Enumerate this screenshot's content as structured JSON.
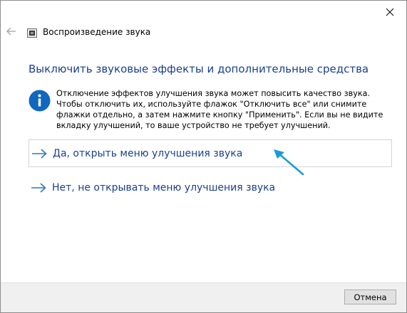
{
  "window": {
    "title": "Воспроизведение звука"
  },
  "heading": "Выключить звуковые эффекты и дополнительные средства",
  "info": {
    "text": "Отключение эффектов улучшения звука может повысить качество звука. Чтобы отключить их, используйте флажок \"Отключить все\" или снимите флажки отдельно, а затем нажмите кнопку \"Применить\". Если вы не видите вкладку улучшений, то ваше устройство не требует улучшений."
  },
  "options": [
    {
      "label": "Да, открыть меню улучшения звука"
    },
    {
      "label": "Нет, не открывать меню улучшения звука"
    }
  ],
  "footer": {
    "cancel_label": "Отмена"
  },
  "colors": {
    "accent": "#1a3f8f",
    "arrow": "#2b78c2",
    "info_icon": "#1167c0",
    "pointer": "#1b9bd6"
  },
  "icons": {
    "close": "close-icon",
    "back": "back-arrow-icon",
    "app": "speaker-app-icon",
    "info": "info-icon",
    "option": "arrow-right-icon",
    "annotation": "annotation-pointer-arrow"
  }
}
